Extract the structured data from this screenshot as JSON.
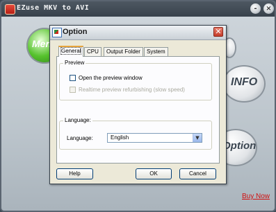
{
  "app": {
    "title": "EZuse MKV to AVI",
    "buttons": {
      "minimize": "-",
      "close": "×"
    },
    "orbs": {
      "menu": "Menu",
      "info": "INFO",
      "option": "Option"
    },
    "buy_now": "Buy Now"
  },
  "dialog": {
    "title": "Option",
    "close": "✕",
    "tabs": [
      "General",
      "CPU",
      "Output Folder",
      "System"
    ],
    "active_tab": "General",
    "preview": {
      "label": "Preview",
      "open_preview": {
        "label": "Open the preview window",
        "checked": false,
        "enabled": true
      },
      "realtime_refresh": {
        "label": "Realtime preview refurbishing (slow speed)",
        "checked": false,
        "enabled": false
      }
    },
    "language": {
      "group_label": "Language:",
      "field_label": "Language:",
      "selected": "English"
    },
    "buttons": {
      "help": "Help",
      "ok": "OK",
      "cancel": "Cancel"
    }
  }
}
